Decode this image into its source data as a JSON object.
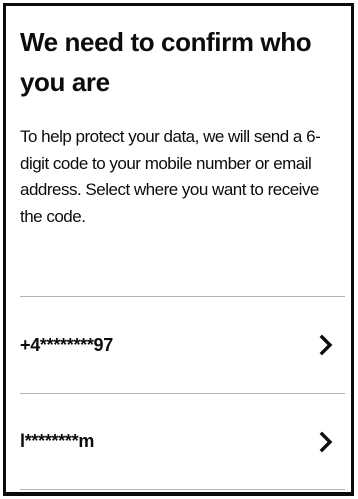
{
  "page": {
    "title": "We need to confirm who you are",
    "description": "To help protect your data, we will send a 6-digit code to your mobile number or email address. Select where you want to receive the code."
  },
  "options": [
    {
      "label": "+4********97",
      "icon": "chevron-right-icon"
    },
    {
      "label": "l********m",
      "icon": "chevron-right-icon"
    }
  ],
  "colors": {
    "text": "#0b0c0c",
    "divider": "#b1b4b6",
    "background": "#ffffff"
  }
}
